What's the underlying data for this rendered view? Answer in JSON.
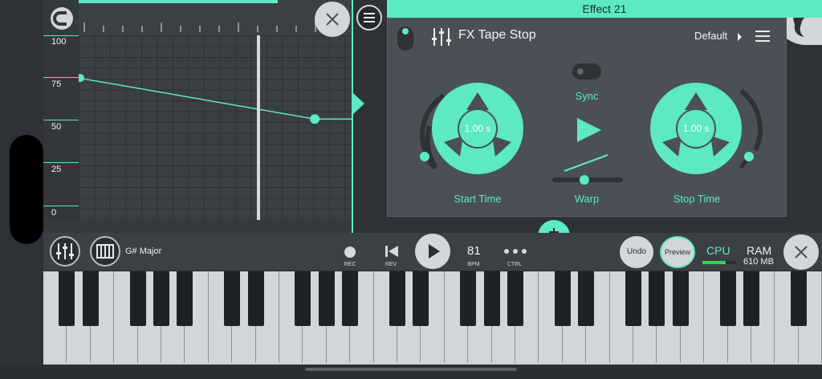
{
  "automation": {
    "axis_labels": [
      "100",
      "75",
      "50",
      "25",
      "0"
    ],
    "points": [
      {
        "x": 0,
        "y": 76
      },
      {
        "x": 0.86,
        "y": 52
      }
    ],
    "playhead_fraction": 0.65
  },
  "effect": {
    "slot_title": "Effect 21",
    "name": "FX Tape Stop",
    "preset": "Default",
    "start_time": {
      "label": "Start Time",
      "value": "1.00 s"
    },
    "stop_time": {
      "label": "Stop Time",
      "value": "1.00 s"
    },
    "sync_label": "Sync",
    "warp_label": "Warp",
    "warp_value": 0.45
  },
  "transport": {
    "scale": "G# Major",
    "rec_label": "REC",
    "rev_label": "REV",
    "bpm_value": "81",
    "bpm_label": "BPM",
    "ctrl_label": "CTRL",
    "undo_label": "Undo",
    "preview_label": "Preview",
    "cpu_label": "CPU",
    "cpu_level": 0.7,
    "ram_label": "RAM",
    "ram_value": "610 MB"
  },
  "colors": {
    "accent": "#5de8c6",
    "panel": "#4a5055",
    "background": "#2e3236"
  },
  "icons": [
    "magnet-icon",
    "close-icon",
    "menu-icon",
    "mixer-icon",
    "piano-icon",
    "play-icon",
    "rewind-icon",
    "record-icon",
    "more-icon",
    "fl-studio-logo"
  ]
}
